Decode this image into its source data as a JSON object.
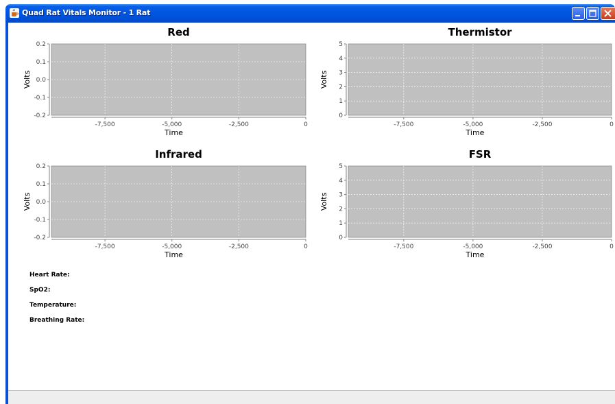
{
  "window": {
    "title": "Quad Rat Vitals Monitor - 1 Rat",
    "colors": {
      "titlebar": "#0054e3",
      "plot_background": "#c0c0c0",
      "close_button": "#d9542c"
    }
  },
  "chart_data": [
    {
      "type": "line",
      "title": "Red",
      "xlabel": "Time",
      "ylabel": "Volts",
      "xlim": [
        -9500,
        0
      ],
      "ylim": [
        -0.2,
        0.2
      ],
      "xticks": [
        -7500,
        -5000,
        -2500,
        0
      ],
      "xtick_labels": [
        "-7,500",
        "-5,000",
        "-2,500",
        "0"
      ],
      "yticks": [
        -0.2,
        -0.1,
        0.0,
        0.1,
        0.2
      ],
      "ytick_labels": [
        "-0.2",
        "-0.1",
        "0.0",
        "0.1",
        "0.2"
      ],
      "grid": true,
      "series": []
    },
    {
      "type": "line",
      "title": "Thermistor",
      "xlabel": "Time",
      "ylabel": "Volts",
      "xlim": [
        -9500,
        0
      ],
      "ylim": [
        0,
        5
      ],
      "xticks": [
        -7500,
        -5000,
        -2500,
        0
      ],
      "xtick_labels": [
        "-7,500",
        "-5,000",
        "-2,500",
        "0"
      ],
      "yticks": [
        0,
        1,
        2,
        3,
        4,
        5
      ],
      "ytick_labels": [
        "0",
        "1",
        "2",
        "3",
        "4",
        "5"
      ],
      "grid": true,
      "series": []
    },
    {
      "type": "line",
      "title": "Infrared",
      "xlabel": "Time",
      "ylabel": "Volts",
      "xlim": [
        -9500,
        0
      ],
      "ylim": [
        -0.2,
        0.2
      ],
      "xticks": [
        -7500,
        -5000,
        -2500,
        0
      ],
      "xtick_labels": [
        "-7,500",
        "-5,000",
        "-2,500",
        "0"
      ],
      "yticks": [
        -0.2,
        -0.1,
        0.0,
        0.1,
        0.2
      ],
      "ytick_labels": [
        "-0.2",
        "-0.1",
        "0.0",
        "0.1",
        "0.2"
      ],
      "grid": true,
      "series": []
    },
    {
      "type": "line",
      "title": "FSR",
      "xlabel": "Time",
      "ylabel": "Volts",
      "xlim": [
        -9500,
        0
      ],
      "ylim": [
        0,
        5
      ],
      "xticks": [
        -7500,
        -5000,
        -2500,
        0
      ],
      "xtick_labels": [
        "-7,500",
        "-5,000",
        "-2,500",
        "0"
      ],
      "yticks": [
        0,
        1,
        2,
        3,
        4,
        5
      ],
      "ytick_labels": [
        "0",
        "1",
        "2",
        "3",
        "4",
        "5"
      ],
      "grid": true,
      "series": []
    }
  ],
  "vitals": [
    {
      "label": "Heart Rate:",
      "value": ""
    },
    {
      "label": "SpO2:",
      "value": ""
    },
    {
      "label": "Temperature:",
      "value": ""
    },
    {
      "label": "Breathing Rate:",
      "value": ""
    }
  ],
  "icons": {
    "app": "java-cup-icon",
    "minimize": "minimize-icon",
    "maximize": "maximize-icon",
    "close": "close-icon"
  }
}
